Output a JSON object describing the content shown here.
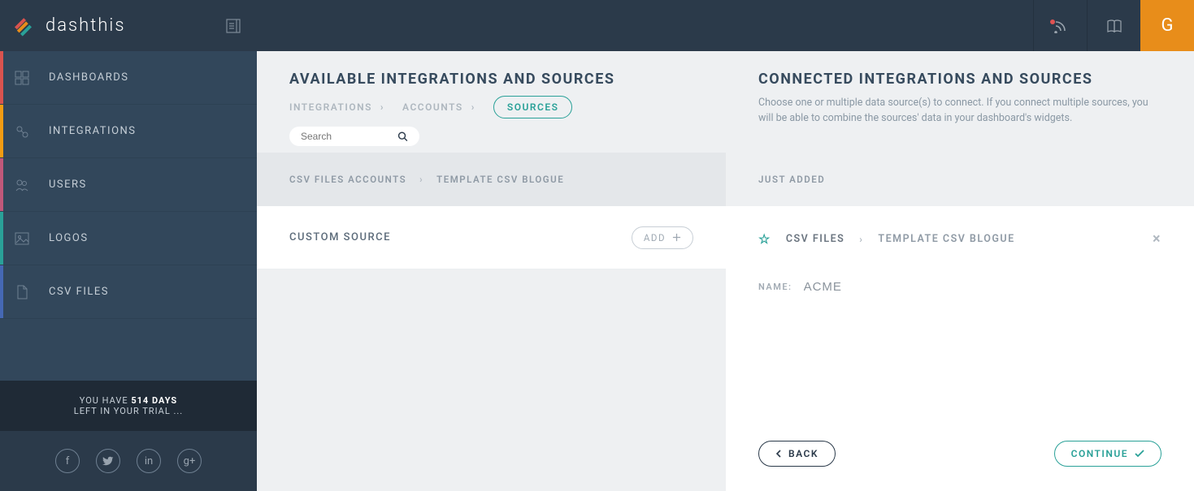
{
  "brand": {
    "name": "dashthis"
  },
  "header": {
    "avatar_initial": "G"
  },
  "sidebar": {
    "items": [
      {
        "label": "DASHBOARDS"
      },
      {
        "label": "INTEGRATIONS"
      },
      {
        "label": "USERS"
      },
      {
        "label": "LOGOS"
      },
      {
        "label": "CSV FILES"
      }
    ],
    "trial": {
      "line1_pre": "YOU HAVE ",
      "days": "514 DAYS",
      "line2": "LEFT IN YOUR TRIAL ..."
    }
  },
  "left": {
    "title": "AVAILABLE INTEGRATIONS AND SOURCES",
    "tabs": {
      "integrations": "INTEGRATIONS",
      "accounts": "ACCOUNTS",
      "sources": "SOURCES"
    },
    "search_placeholder": "Search",
    "breadcrumb": {
      "a": "CSV FILES ACCOUNTS",
      "b": "TEMPLATE CSV BLOGUE"
    },
    "source_row": {
      "title": "CUSTOM SOURCE",
      "add": "ADD"
    }
  },
  "right": {
    "title": "CONNECTED INTEGRATIONS AND SOURCES",
    "desc": "Choose one or multiple data source(s) to connect. If you connect multiple sources, you will be able to combine the sources' data in your dashboard's widgets.",
    "subhead": "JUST ADDED",
    "breadcrumb": {
      "a": "CSV FILES",
      "b": "TEMPLATE CSV BLOGUE"
    },
    "name_label": "NAME:",
    "name_value": "ACME",
    "back": "BACK",
    "continue": "CONTINUE"
  }
}
